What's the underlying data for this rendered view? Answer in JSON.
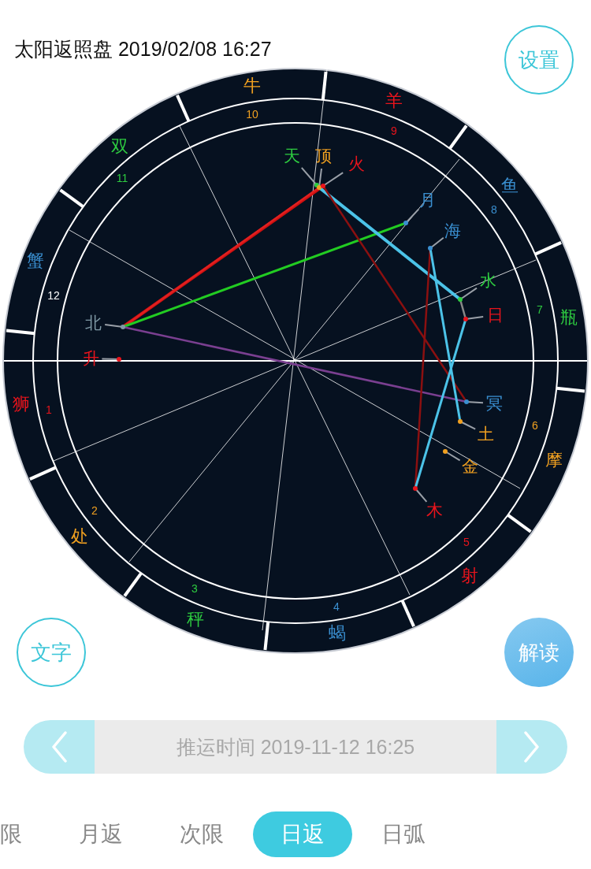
{
  "header": {
    "title": "太阳返照盘 2019/02/08 16:27"
  },
  "buttons": {
    "settings": "设置",
    "text": "文字",
    "interpret": "解读"
  },
  "chart": {
    "signs": [
      {
        "label": "牛",
        "color": "#f0a020"
      },
      {
        "label": "羊",
        "color": "#e8141c"
      },
      {
        "label": "鱼",
        "color": "#3a8fd0"
      },
      {
        "label": "瓶",
        "color": "#2ecc40"
      },
      {
        "label": "摩",
        "color": "#f0a020"
      },
      {
        "label": "射",
        "color": "#e8141c"
      },
      {
        "label": "蝎",
        "color": "#3a8fd0"
      },
      {
        "label": "秤",
        "color": "#2ecc40"
      },
      {
        "label": "处",
        "color": "#f0a020"
      },
      {
        "label": "狮",
        "color": "#e8141c"
      },
      {
        "label": "蟹",
        "color": "#3a8fd0"
      },
      {
        "label": "双",
        "color": "#2ecc40"
      }
    ],
    "houses": [
      {
        "number": "10",
        "color": "#f0a020"
      },
      {
        "number": "9",
        "color": "#e8141c"
      },
      {
        "number": "8",
        "color": "#3a8fd0"
      },
      {
        "number": "7",
        "color": "#2ecc40"
      },
      {
        "number": "6",
        "color": "#f0a020"
      },
      {
        "number": "5",
        "color": "#e8141c"
      },
      {
        "number": "4",
        "color": "#3a8fd0"
      },
      {
        "number": "3",
        "color": "#2ecc40"
      },
      {
        "number": "2",
        "color": "#f0a020"
      },
      {
        "number": "1",
        "color": "#e8141c"
      },
      {
        "number": "12",
        "color": "#ffffff"
      },
      {
        "number": "11",
        "color": "#2ecc40"
      }
    ],
    "planets": [
      {
        "label": "天",
        "color": "#2ecc40"
      },
      {
        "label": "顶",
        "color": "#f0a020"
      },
      {
        "label": "火",
        "color": "#e8141c"
      },
      {
        "label": "月",
        "color": "#3a8fd0"
      },
      {
        "label": "海",
        "color": "#3a8fd0"
      },
      {
        "label": "水",
        "color": "#2ecc40"
      },
      {
        "label": "日",
        "color": "#e8141c"
      },
      {
        "label": "北",
        "color": "#7f99a5"
      },
      {
        "label": "升",
        "color": "#e8141c"
      },
      {
        "label": "冥",
        "color": "#3a8fd0"
      },
      {
        "label": "土",
        "color": "#f0a020"
      },
      {
        "label": "金",
        "color": "#f0a020"
      },
      {
        "label": "木",
        "color": "#e8141c"
      }
    ]
  },
  "time_bar": {
    "label": "推运时间 2019-11-12 16:25"
  },
  "tabs": [
    {
      "label": "限",
      "selected": false
    },
    {
      "label": "月返",
      "selected": false
    },
    {
      "label": "次限",
      "selected": false
    },
    {
      "label": "日返",
      "selected": true
    },
    {
      "label": "日弧",
      "selected": false
    }
  ]
}
